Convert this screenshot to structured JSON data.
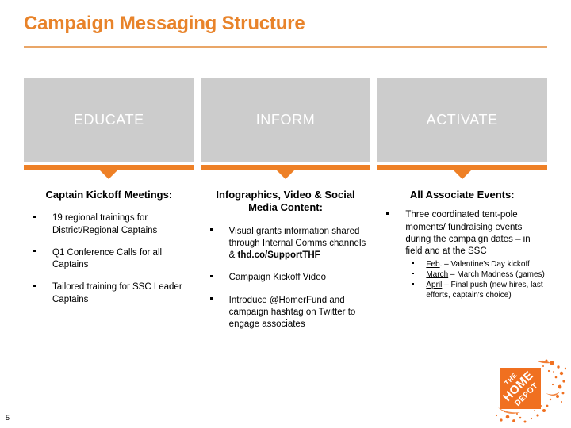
{
  "slide": {
    "title": "Campaign Messaging Structure",
    "page_number": "5",
    "accent_orange": "#EE8026",
    "title_orange": "#E8832A",
    "band_gray": "#cccccc"
  },
  "band": {
    "cells": [
      {
        "label": "EDUCATE"
      },
      {
        "label": "INFORM"
      },
      {
        "label": "ACTIVATE"
      }
    ]
  },
  "columns": [
    {
      "heading": "Captain Kickoff Meetings:",
      "bullets": [
        {
          "text": "19 regional trainings for District/Regional Captains"
        },
        {
          "text": "Q1 Conference Calls for all Captains"
        },
        {
          "text": "Tailored training for SSC Leader Captains"
        }
      ]
    },
    {
      "heading": "Infographics, Video & Social Media Content:",
      "bullets": [
        {
          "text": "Visual grants information shared through Internal Comms channels & ",
          "bold_tail": "thd.co/SupportTHF"
        },
        {
          "text": "Campaign Kickoff Video"
        },
        {
          "text": "Introduce @HomerFund and campaign hashtag on Twitter to engage associates"
        }
      ]
    },
    {
      "heading": "All Associate Events:",
      "bullets": [
        {
          "text": "Three coordinated tent-pole moments/ fundraising events during the campaign dates – in field and at the SSC",
          "subbullets": [
            {
              "underlined": "Feb",
              "text": ". – Valentine's Day kickoff"
            },
            {
              "underlined": "March",
              "text": " – March Madness (games)"
            },
            {
              "underlined": "April",
              "text": " – Final push (new hires, last efforts, captain's choice)"
            }
          ]
        }
      ]
    }
  ],
  "logo": {
    "name": "the-home-depot-logo",
    "line1": "THE",
    "line2": "HOME",
    "line3": "DEPOT",
    "color": "#F07020"
  }
}
